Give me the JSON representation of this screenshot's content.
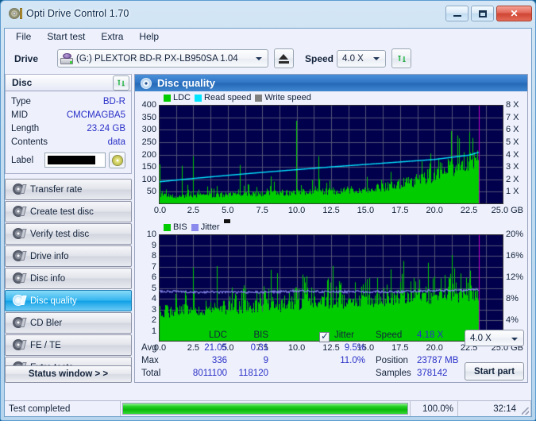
{
  "window": {
    "title": "Opti Drive Control 1.70",
    "app_icon": "disc-icon",
    "minimize": "minimize",
    "maximize": "maximize",
    "close": "✕"
  },
  "menu": {
    "items": [
      "File",
      "Start test",
      "Extra",
      "Help"
    ]
  },
  "toolbar": {
    "drive_label": "Drive",
    "drive_value": "(G:)  PLEXTOR BD-R  PX-LB950SA 1.04",
    "eject_icon": "eject-icon",
    "speed_label": "Speed",
    "speed_value": "4.0 X",
    "refresh_icon": "refresh-icon"
  },
  "disc": {
    "header": "Disc",
    "refresh_icon": "refresh-icon",
    "rows": [
      {
        "key": "Type",
        "value": "BD-R"
      },
      {
        "key": "MID",
        "value": "CMCMAGBA5"
      },
      {
        "key": "Length",
        "value": "23.24 GB"
      },
      {
        "key": "Contents",
        "value": "data"
      }
    ],
    "label_key": "Label",
    "label_value": "",
    "label_button_icon": "disc-icon"
  },
  "nav": {
    "items": [
      {
        "label": "Transfer rate",
        "selected": false
      },
      {
        "label": "Create test disc",
        "selected": false
      },
      {
        "label": "Verify test disc",
        "selected": false
      },
      {
        "label": "Drive info",
        "selected": false
      },
      {
        "label": "Disc info",
        "selected": false
      },
      {
        "label": "Disc quality",
        "selected": true
      },
      {
        "label": "CD Bler",
        "selected": false
      },
      {
        "label": "FE / TE",
        "selected": false
      },
      {
        "label": "Extra tests",
        "selected": false
      }
    ],
    "status_window": "Status window > >"
  },
  "content": {
    "title": "Disc quality",
    "title_icon": "disc-quality-icon"
  },
  "stats": {
    "col_headers": [
      "LDC",
      "BIS"
    ],
    "jitter_label": "Jitter",
    "jitter_checked": true,
    "rows": [
      {
        "name": "Avg",
        "ldc": "21.05",
        "bis": "0.31",
        "jitter": "9.5%"
      },
      {
        "name": "Max",
        "ldc": "336",
        "bis": "9",
        "jitter": "11.0%"
      },
      {
        "name": "Total",
        "ldc": "8011100",
        "bis": "118120",
        "jitter": ""
      }
    ],
    "speed_key": "Speed",
    "speed_val": "4.18 X",
    "position_key": "Position",
    "position_val": "23787 MB",
    "samples_key": "Samples",
    "samples_val": "378142",
    "speed_select": "4.0 X",
    "start_part": "Start part"
  },
  "statusbar": {
    "status": "Test completed",
    "percent": "100.0%",
    "time": "32:14",
    "progress_value": 100
  },
  "colors": {
    "plot_bg": "#00004c",
    "grid": "#555577",
    "ldc_green": "#00cc00",
    "read_speed_cyan": "#00e5ff",
    "write_speed_gray": "#808080",
    "bis_green": "#00cc00",
    "jitter_blue": "#8a8aee",
    "marker_magenta": "#cc00cc",
    "accent_blue": "#2a31c8",
    "selection_blue": "#0fa1e6"
  },
  "chart_data": [
    {
      "type": "area",
      "id": "ldc-chart",
      "title": "",
      "xlabel": "GB",
      "ylabel": "LDC",
      "legend": [
        {
          "name": "LDC",
          "color": "#00cc00"
        },
        {
          "name": "Read speed",
          "color": "#00e5ff"
        },
        {
          "name": "Write speed",
          "color": "#808080"
        }
      ],
      "legend_position": "top-left",
      "grid": true,
      "xlim": [
        0,
        25.0
      ],
      "ylim": [
        0,
        400
      ],
      "ylim_right": [
        0,
        8
      ],
      "xticks": [
        0.0,
        2.5,
        5.0,
        7.5,
        10.0,
        12.5,
        15.0,
        17.5,
        20.0,
        22.5,
        25.0
      ],
      "xticklabels": [
        "0.0",
        "2.5",
        "5.0",
        "7.5",
        "10.0",
        "12.5",
        "15.0",
        "17.5",
        "20.0",
        "22.5",
        "25.0 GB"
      ],
      "yticks": [
        50,
        100,
        150,
        200,
        250,
        300,
        350,
        400
      ],
      "yticklabels": [
        "50",
        "100",
        "150",
        "200",
        "250",
        "300",
        "350",
        "400"
      ],
      "yticks_right": [
        1,
        2,
        3,
        4,
        5,
        6,
        7,
        8
      ],
      "yticklabels_right": [
        "1 X",
        "2 X",
        "3 X",
        "4 X",
        "5 X",
        "6 X",
        "7 X",
        "8 X"
      ],
      "data_end_x": 23.24,
      "marker_x": 23.24,
      "series": [
        {
          "name": "LDC",
          "type": "area",
          "color": "#00cc00",
          "x": [
            0.0,
            0.5,
            1.0,
            1.5,
            2.0,
            2.5,
            3.0,
            3.5,
            4.0,
            4.5,
            5.0,
            5.5,
            6.0,
            6.5,
            7.0,
            7.5,
            8.0,
            8.5,
            9.0,
            9.5,
            10.0,
            10.5,
            11.0,
            11.5,
            12.0,
            12.5,
            13.0,
            13.5,
            14.0,
            14.5,
            15.0,
            15.5,
            16.0,
            16.5,
            17.0,
            17.5,
            18.0,
            18.5,
            19.0,
            19.5,
            20.0,
            20.5,
            21.0,
            21.5,
            22.0,
            22.5,
            23.0,
            23.24
          ],
          "values": [
            40,
            35,
            33,
            34,
            36,
            38,
            36,
            35,
            37,
            38,
            38,
            39,
            40,
            41,
            42,
            43,
            44,
            45,
            46,
            47,
            48,
            49,
            50,
            51,
            52,
            53,
            54,
            56,
            58,
            60,
            62,
            65,
            68,
            72,
            76,
            82,
            88,
            95,
            103,
            112,
            122,
            133,
            145,
            158,
            172,
            188,
            200,
            205
          ]
        },
        {
          "name": "Read speed",
          "type": "line",
          "color": "#00e5ff",
          "x": [
            0.0,
            2.5,
            5.0,
            7.5,
            10.0,
            12.5,
            15.0,
            17.5,
            20.0,
            22.5,
            23.24
          ],
          "values_x": [
            1.8,
            2.07,
            2.32,
            2.56,
            2.78,
            3.0,
            3.2,
            3.4,
            3.6,
            3.95,
            4.18
          ]
        }
      ],
      "peaks": [
        {
          "x": 0.05,
          "y": 160
        },
        {
          "x": 1.65,
          "y": 155
        },
        {
          "x": 2.45,
          "y": 193
        },
        {
          "x": 5.85,
          "y": 158
        },
        {
          "x": 8.15,
          "y": 112
        },
        {
          "x": 9.95,
          "y": 336
        },
        {
          "x": 11.55,
          "y": 193
        },
        {
          "x": 15.1,
          "y": 110
        },
        {
          "x": 16.8,
          "y": 130
        },
        {
          "x": 21.8,
          "y": 265
        }
      ]
    },
    {
      "type": "area",
      "id": "bis-chart",
      "title": "",
      "xlabel": "GB",
      "ylabel": "BIS",
      "legend": [
        {
          "name": "BIS",
          "color": "#00cc00"
        },
        {
          "name": "Jitter",
          "color": "#8a8aee"
        }
      ],
      "legend_position": "top-left",
      "grid": true,
      "xlim": [
        0,
        25.0
      ],
      "ylim": [
        0,
        10
      ],
      "ylim_right": [
        0,
        20
      ],
      "xticks": [
        0.0,
        2.5,
        5.0,
        7.5,
        10.0,
        12.5,
        15.0,
        17.5,
        20.0,
        22.5,
        25.0
      ],
      "xticklabels": [
        "0.0",
        "2.5",
        "5.0",
        "7.5",
        "10.0",
        "12.5",
        "15.0",
        "17.5",
        "20.0",
        "22.5",
        "25.0 GB"
      ],
      "yticks": [
        1,
        2,
        3,
        4,
        5,
        6,
        7,
        8,
        9,
        10
      ],
      "yticklabels": [
        "1",
        "2",
        "3",
        "4",
        "5",
        "6",
        "7",
        "8",
        "9",
        "10"
      ],
      "yticks_right": [
        4,
        8,
        12,
        16,
        20
      ],
      "yticklabels_right": [
        "4%",
        "8%",
        "12%",
        "16%",
        "20%"
      ],
      "data_end_x": 23.24,
      "marker_x": 23.24,
      "series": [
        {
          "name": "BIS",
          "type": "area",
          "color": "#00cc00",
          "baseline": 3.0,
          "note": "dense bars around 2-4 rising to 4-6 near end"
        },
        {
          "name": "Jitter",
          "type": "line",
          "color": "#8a8aee",
          "x": [
            0.0,
            2.5,
            5.0,
            7.5,
            10.0,
            12.5,
            15.0,
            17.5,
            20.0,
            22.5,
            23.24
          ],
          "values_pct": [
            9.4,
            9.2,
            9.2,
            9.2,
            9.4,
            9.3,
            9.3,
            9.3,
            9.5,
            9.6,
            9.7
          ]
        }
      ]
    }
  ]
}
